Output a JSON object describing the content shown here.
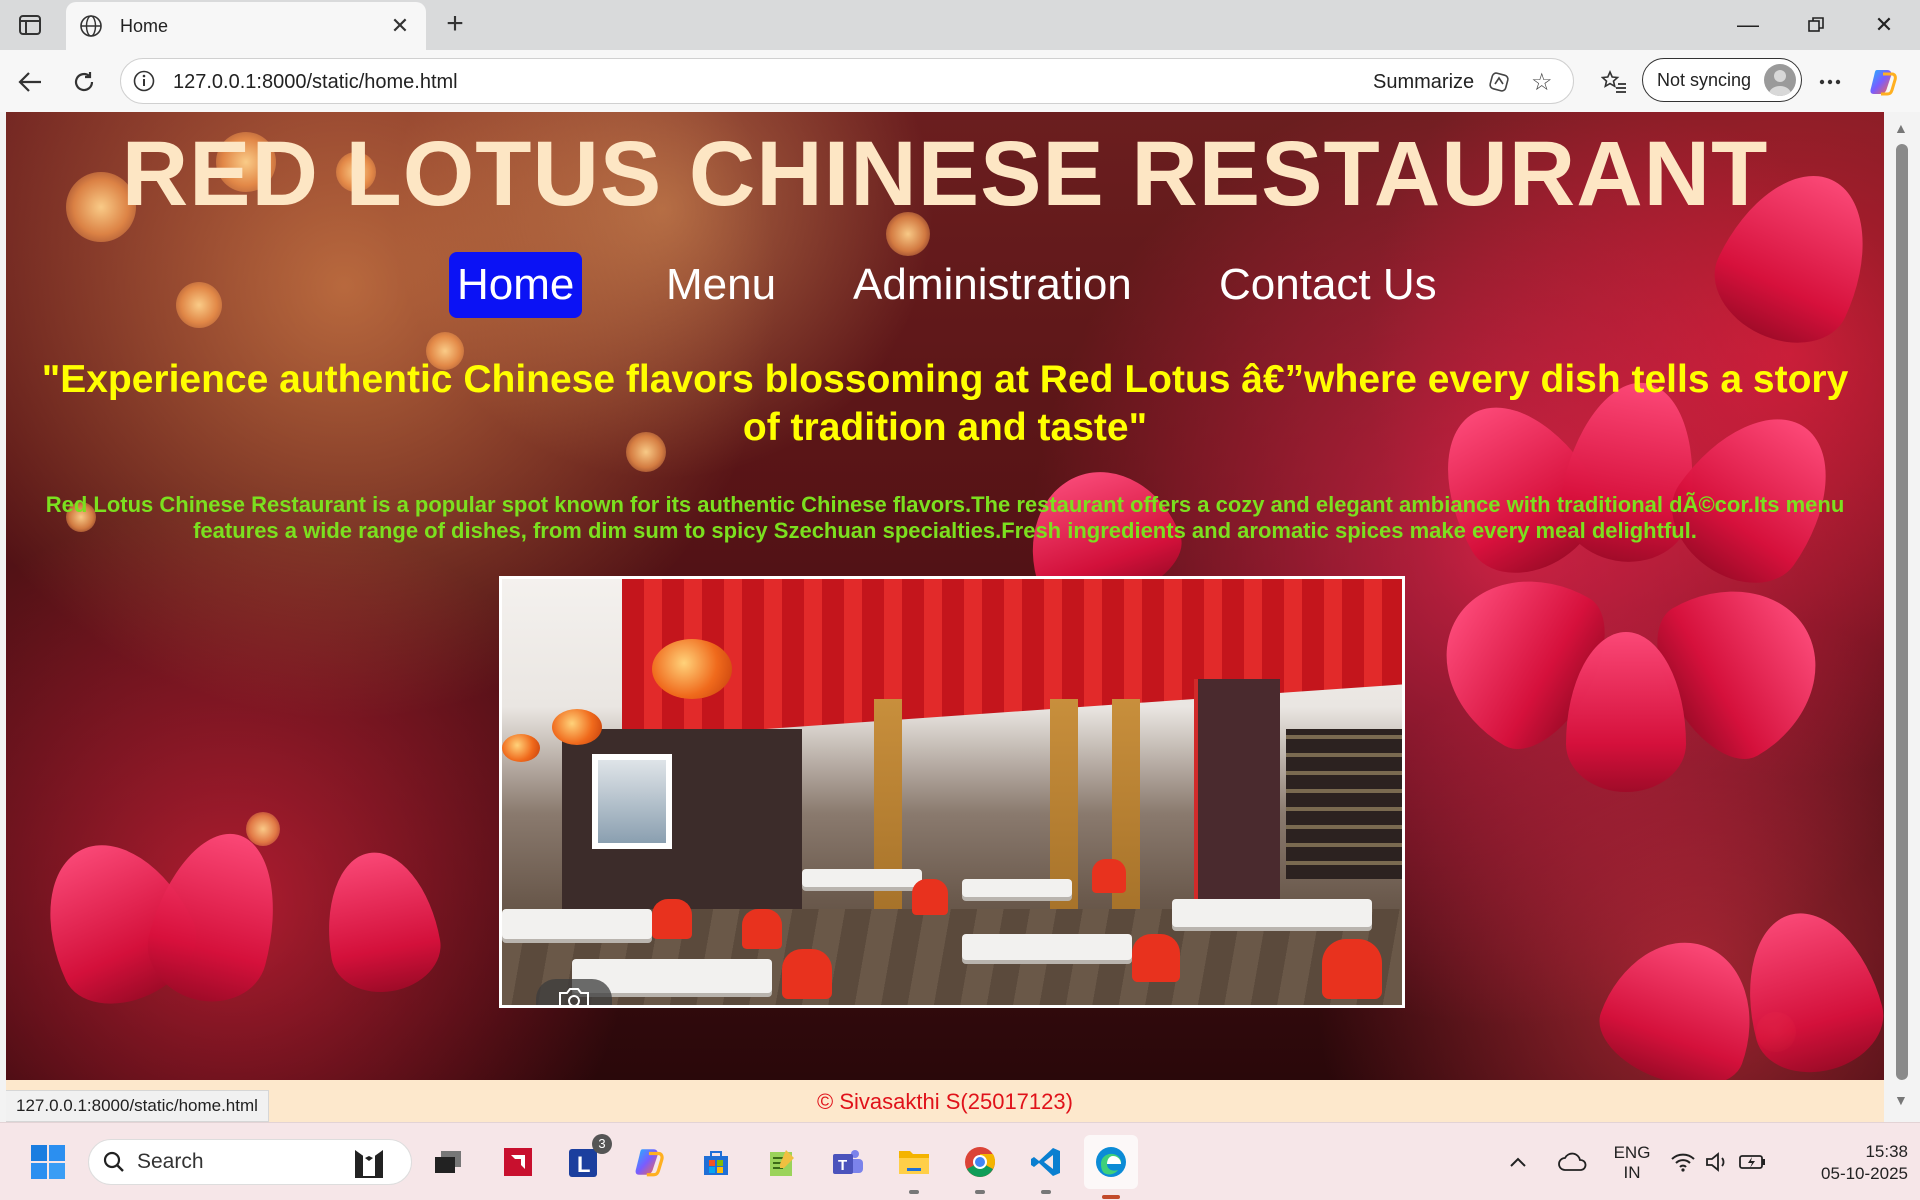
{
  "browser": {
    "tab_title": "Home",
    "new_tab_symbol": "+",
    "url": "127.0.0.1:8000/static/home.html",
    "summarize_label": "Summarize",
    "sync_label": "Not syncing",
    "status_url": "127.0.0.1:8000/static/home.html",
    "icons": [
      "tab-actions-icon",
      "globe-icon",
      "close-icon",
      "back-icon",
      "refresh-icon",
      "info-icon",
      "copilot-summarize-icon",
      "star-icon",
      "favorites-icon",
      "more-icon",
      "copilot-icon"
    ]
  },
  "page": {
    "title": "RED LOTUS CHINESE RESTAURANT",
    "nav": [
      {
        "label": "Home",
        "active": true
      },
      {
        "label": "Menu",
        "active": false
      },
      {
        "label": "Administration",
        "active": false
      },
      {
        "label": "Contact Us",
        "active": false
      }
    ],
    "tagline": "\"Experience authentic Chinese flavors blossoming at Red Lotus â€”where every dish tells a story of tradition and taste\"",
    "description": "Red Lotus Chinese Restaurant is a popular spot known for its authentic Chinese flavors.The restaurant offers a cozy and elegant ambiance with traditional dÃ©cor.Its menu features a wide range of dishes, from dim sum to spicy Szechuan specialties.Fresh ingredients and aromatic spices make every meal delightful.",
    "footer": "© Sivasakthi S(25017123)",
    "colors": {
      "title": "#fde6c4",
      "nav_active": "#0b12f5",
      "tagline": "#ffff00",
      "description": "#7be01f",
      "footer_text": "#e0121a",
      "footer_bg": "#fde8cc"
    }
  },
  "taskbar": {
    "search_placeholder": "Search",
    "lang_line1": "ENG",
    "lang_line2": "IN",
    "time": "15:38",
    "date": "05-10-2025",
    "badge_count": "3",
    "apps": [
      "start-icon",
      "tuxedo-icon",
      "task-view-icon",
      "amd-icon",
      "l-app-icon",
      "copilot-icon",
      "store-icon",
      "notepad-icon",
      "teams-icon",
      "file-explorer-icon",
      "chrome-icon",
      "vscode-icon",
      "edge-icon"
    ],
    "tray": [
      "chevron-up-icon",
      "onedrive-icon",
      "wifi-icon",
      "volume-icon",
      "battery-icon"
    ]
  }
}
